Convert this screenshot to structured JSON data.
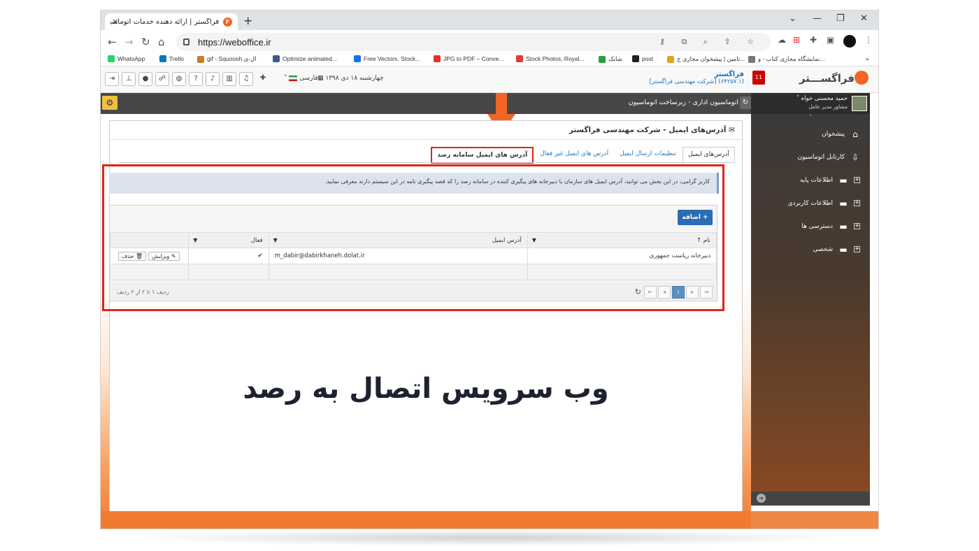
{
  "browser": {
    "tab_title": "فراگستر | ارائه دهنده خدمات اتوماسیون اد",
    "tab_close": "✕",
    "new_tab": "+",
    "url": "https://weboffice.ir",
    "win_min": "—",
    "win_max": "❐",
    "win_close": "✕",
    "win_chevron": "⌄"
  },
  "bookmarks": [
    {
      "label": "WhatsApp",
      "color": "#25d366"
    },
    {
      "label": "Trello",
      "color": "#0079bf"
    },
    {
      "label": "gif - Squoosh.ال-ی",
      "color": "#c57d2a"
    },
    {
      "label": "Optimize animated...",
      "color": "#3a5a8c"
    },
    {
      "label": "Free Vectors, Stock...",
      "color": "#1273eb"
    },
    {
      "label": "JPG to PDF – Conve...",
      "color": "#e5322d"
    },
    {
      "label": "Stock Photos, Royal...",
      "color": "#e53935"
    },
    {
      "label": "شابک",
      "color": "#2e9d3f"
    },
    {
      "label": "post",
      "color": "#222222"
    },
    {
      "label": "تامین | پیشخوان مجازی ج...",
      "color": "#e8a21a"
    },
    {
      "label": "نمایشگاه مجازی کتاب - و...",
      "color": "#777777"
    }
  ],
  "header": {
    "language": "فارسی",
    "date": "چهارشنبه ۱۸ دی ۱۳۹۸",
    "company_name": "فراگستر",
    "company_sub": "(۶۴۲۵۷.۱) [شرکت مهندسی فراگستر]",
    "badge": "11",
    "logo": "فراگســـتر"
  },
  "darkbar": {
    "breadcrumb": "اتوماسیون اداری - زیرساخت اتوماسیون"
  },
  "sidebar": {
    "user_name": "حمید محسنی خواه ˅",
    "user_role": "مشاور مدیر عامل",
    "items": [
      {
        "label": "پیشخوان",
        "icon": "home-icon",
        "glyph": "⌂",
        "expand": ""
      },
      {
        "label": "کارتابل اتوماسیون",
        "icon": "inbox-icon",
        "glyph": "⇩",
        "expand": ""
      },
      {
        "label": "اطلاعات پایه",
        "icon": "folder-icon",
        "glyph": "▬",
        "expand": "+"
      },
      {
        "label": "اطلاعات کاربردی",
        "icon": "folder-icon",
        "glyph": "▬",
        "expand": "+"
      },
      {
        "label": "دسترسی ها",
        "icon": "folder-icon",
        "glyph": "▬",
        "expand": "+"
      },
      {
        "label": "شخصی",
        "icon": "folder-icon",
        "glyph": "▬",
        "expand": "+"
      }
    ]
  },
  "panel": {
    "title": "آدرس‌های ایمیل - شرکت مهندسی فراگستر",
    "tabs": [
      "آدرس‌های ایمیل",
      "تنظیمات ارسال ایمیل",
      "آدرس های ایمیل غیر فعال",
      "آدرس های ایمیل سامانه رصد"
    ],
    "info": "کاربر گرامی، در این بخش می توانید، آدرس ایمیل های سازمان یا دبیرخانه های پیگیری کننده در سامانه رصد را که قصد پیگیری نامه در این سیستم دارند معرفی نمایید.",
    "add_label": "+ اضافه"
  },
  "table": {
    "headers": {
      "name": "نام ↑",
      "email": "آدرس ایمیل",
      "active": "فعال",
      "actions": ""
    },
    "rows": [
      {
        "name": "دبیرخانه ریاست جمهوری",
        "email": "m_dabir@dabirkhaneh.dolat.ir",
        "active": "✔",
        "edit": "ویرایش",
        "delete": "حذف"
      }
    ]
  },
  "pager": {
    "current_page": "۱",
    "summary": "ردیف ۱ تا ۲ از ۲ ردیف"
  },
  "headline": "وب سرویس اتصال به رصد",
  "colors": {
    "accent": "#f26522",
    "highlight": "#e2231a",
    "primary_button": "#2a6db5"
  }
}
